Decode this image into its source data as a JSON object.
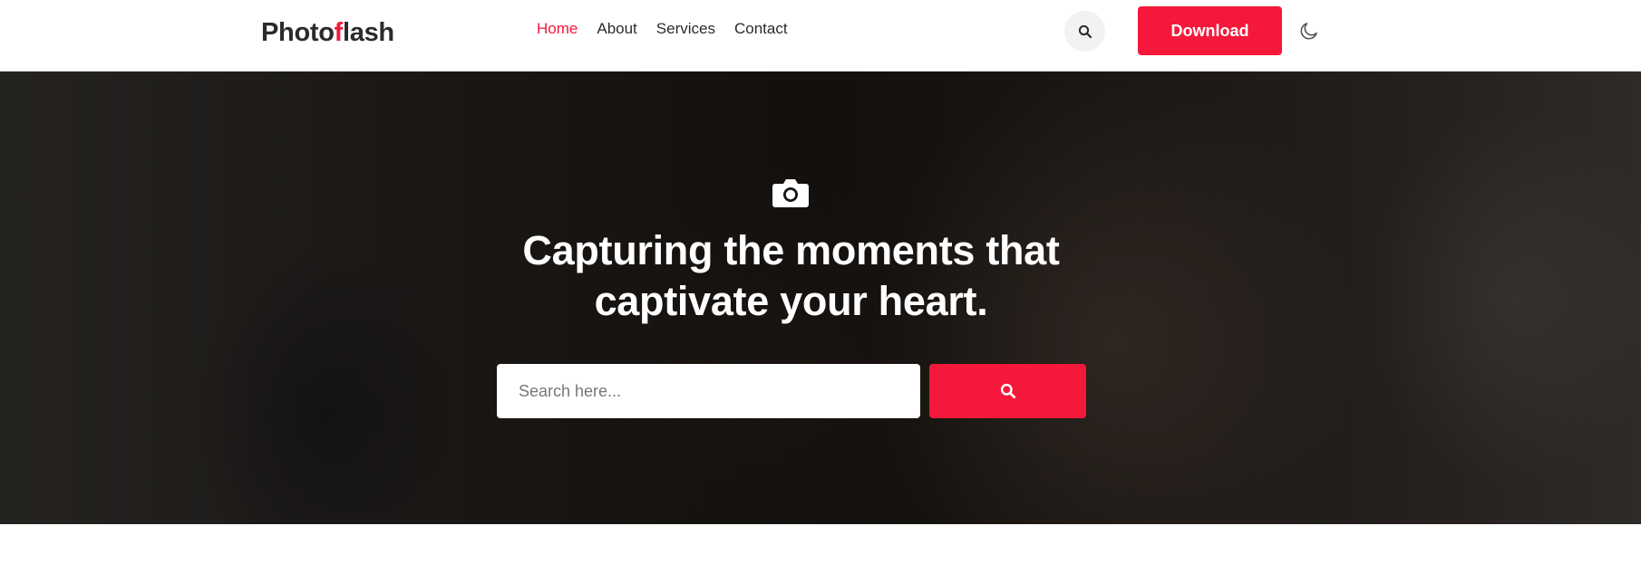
{
  "header": {
    "logo": {
      "part1": "Photo",
      "part2": "f",
      "part3": "lash"
    },
    "nav": [
      {
        "label": "Home",
        "active": true
      },
      {
        "label": "About",
        "active": false
      },
      {
        "label": "Services",
        "active": false
      },
      {
        "label": "Contact",
        "active": false
      }
    ],
    "search_icon": "search-icon",
    "download_label": "Download",
    "theme_icon": "moon-icon"
  },
  "hero": {
    "camera_icon": "camera-icon",
    "title_line1": "Capturing the moments that",
    "title_line2": "captivate your heart.",
    "search": {
      "placeholder": "Search here...",
      "value": ""
    },
    "search_button_icon": "search-icon"
  },
  "colors": {
    "accent": "#f5183a",
    "text": "#2b2b2b",
    "header_bg": "#ffffff"
  }
}
